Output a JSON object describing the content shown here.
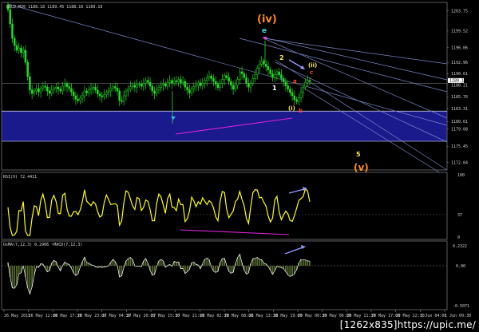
{
  "chart_data": [
    {
      "type": "candlestick",
      "title": "GOLD,M30  1188.18 1189.45 1188.16 1189.19",
      "y_ticks": [
        "1203.75",
        "1199.52",
        "1196.06",
        "1192.96",
        "1190.61",
        "1188.21",
        "1185.76",
        "1183.31",
        "1180.61",
        "1179.08",
        "1175.45",
        "1172.04"
      ],
      "last_price": "1189.19",
      "ylim": [
        1170.5,
        1205.5
      ],
      "support_zone": {
        "from": 1176.5,
        "to": 1182.8,
        "color": "#1a1a8c"
      },
      "closes": [
        1204.0,
        1201.0,
        1198.0,
        1196.5,
        1195.5,
        1196.0,
        1195.0,
        1195.5,
        1193.0,
        1190.0,
        1187.2,
        1186.5,
        1187.0,
        1187.5,
        1186.8,
        1187.5,
        1188.0,
        1187.8,
        1187.0,
        1186.5,
        1187.2,
        1187.6,
        1187.8,
        1187.4,
        1187.0,
        1188.0,
        1188.5,
        1187.9,
        1187.5,
        1186.8,
        1186.0,
        1185.3,
        1185.0,
        1185.5,
        1186.0,
        1187.0,
        1186.6,
        1187.2,
        1187.6,
        1187.8,
        1187.2,
        1186.4,
        1186.0,
        1185.8,
        1186.2,
        1186.7,
        1187.0,
        1187.5,
        1187.9,
        1187.6,
        1187.0,
        1185.0,
        1184.8,
        1186.0,
        1187.0,
        1187.4,
        1187.9,
        1188.2,
        1187.8,
        1188.3,
        1188.4,
        1188.0,
        1188.6,
        1189.2,
        1188.8,
        1188.0,
        1187.0,
        1186.5,
        1187.2,
        1187.8,
        1188.2,
        1188.5,
        1188.0,
        1188.8,
        1189.2,
        1188.6,
        1189.1,
        1188.9,
        1189.4,
        1188.7,
        1189.0,
        1187.8,
        1187.2,
        1186.6,
        1187.4,
        1187.9,
        1188.2,
        1188.7,
        1188.1,
        1188.6,
        1189.2,
        1189.7,
        1190.1,
        1189.6,
        1189.0,
        1188.4,
        1187.7,
        1188.6,
        1189.4,
        1190.2,
        1189.8,
        1189.0,
        1188.2,
        1187.4,
        1188.2,
        1189.4,
        1191.0,
        1190.6,
        1189.8,
        1188.6,
        1187.8,
        1188.6,
        1189.6,
        1190.4,
        1191.8,
        1192.6,
        1193.2,
        1192.6,
        1192.1,
        1191.4,
        1190.6,
        1189.8,
        1190.4,
        1191.0,
        1190.4,
        1189.6,
        1188.9,
        1188.1,
        1187.4,
        1186.7,
        1186.0,
        1185.2,
        1184.8,
        1185.6,
        1186.8,
        1187.8,
        1188.8,
        1189.2,
        1189.19
      ],
      "indicators": [
        {
          "label": "RSI(9) 72.4411",
          "levels": [
            "100",
            "37",
            "0"
          ]
        },
        {
          "label": "OsMA(7,12,3) 0.2906   ~MACD(7,12,3)",
          "levels": [
            "0.2322",
            "0.00",
            "-0.5071"
          ]
        }
      ],
      "x_ticks": [
        "26 May 2015",
        "26 May 12:00",
        "26 May 17:30",
        "26 May 23:00",
        "27 May 04:30",
        "27 May 10:00",
        "27 May 15:30",
        "27 May 21:00",
        "28 May 02:30",
        "28 May 08:00",
        "28 May 13:30",
        "28 May 19:00",
        "29 May 00:30",
        "29 May 06:00",
        "29 May 11:30",
        "29 May 17:00",
        "29 May 22:30",
        "1 Jun 04:00",
        "1 Jun 09:30"
      ],
      "wave_labels": [
        "(iv)",
        "e",
        "2",
        "(ii)",
        "c",
        "a",
        "1",
        "(i)",
        "b",
        "5",
        "(v)"
      ],
      "colors": {
        "bull": "#22dd22",
        "bear": "#22dd22",
        "rsi": "#ffff00",
        "osma": "#556b2f",
        "trend": "#7a86c8",
        "div": "#dd22dd"
      }
    }
  ],
  "watermark": "[1262x835]https://upic.me/"
}
